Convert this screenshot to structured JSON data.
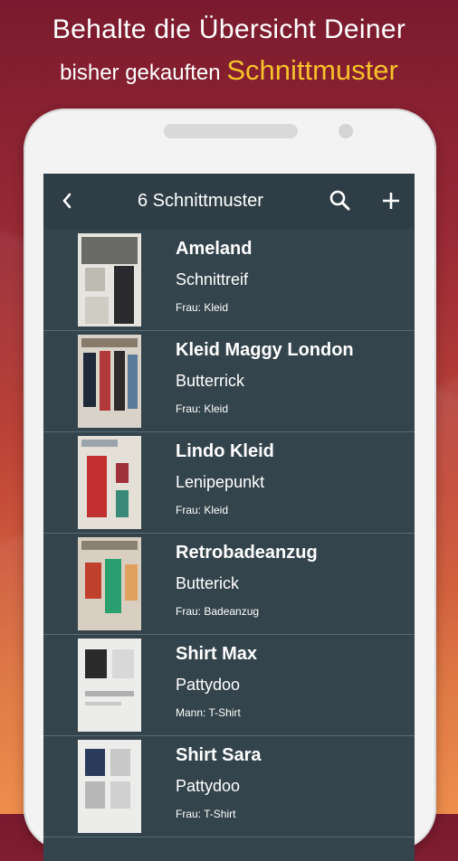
{
  "promo": {
    "line1": "Behalte die Übersicht Deiner",
    "line2_prefix": "bisher gekauften",
    "line2_accent": "Schnittmuster"
  },
  "appbar": {
    "title": "6 Schnittmuster",
    "back_icon": "chevron-left-icon",
    "search_icon": "search-icon",
    "add_icon": "plus-icon"
  },
  "colors": {
    "accent": "#f6c12a",
    "appbar": "#2f3e46",
    "list_bg": "#34444c"
  },
  "patterns": [
    {
      "name": "Ameland",
      "brand": "Schnittreif",
      "category": "Frau: Kleid"
    },
    {
      "name": "Kleid Maggy London",
      "brand": "Butterrick",
      "category": "Frau: Kleid"
    },
    {
      "name": "Lindo Kleid",
      "brand": "Lenipepunkt",
      "category": "Frau: Kleid"
    },
    {
      "name": "Retrobadeanzug",
      "brand": "Butterick",
      "category": "Frau: Badeanzug"
    },
    {
      "name": "Shirt Max",
      "brand": "Pattydoo",
      "category": "Mann: T-Shirt"
    },
    {
      "name": "Shirt Sara",
      "brand": "Pattydoo",
      "category": "Frau: T-Shirt"
    }
  ]
}
